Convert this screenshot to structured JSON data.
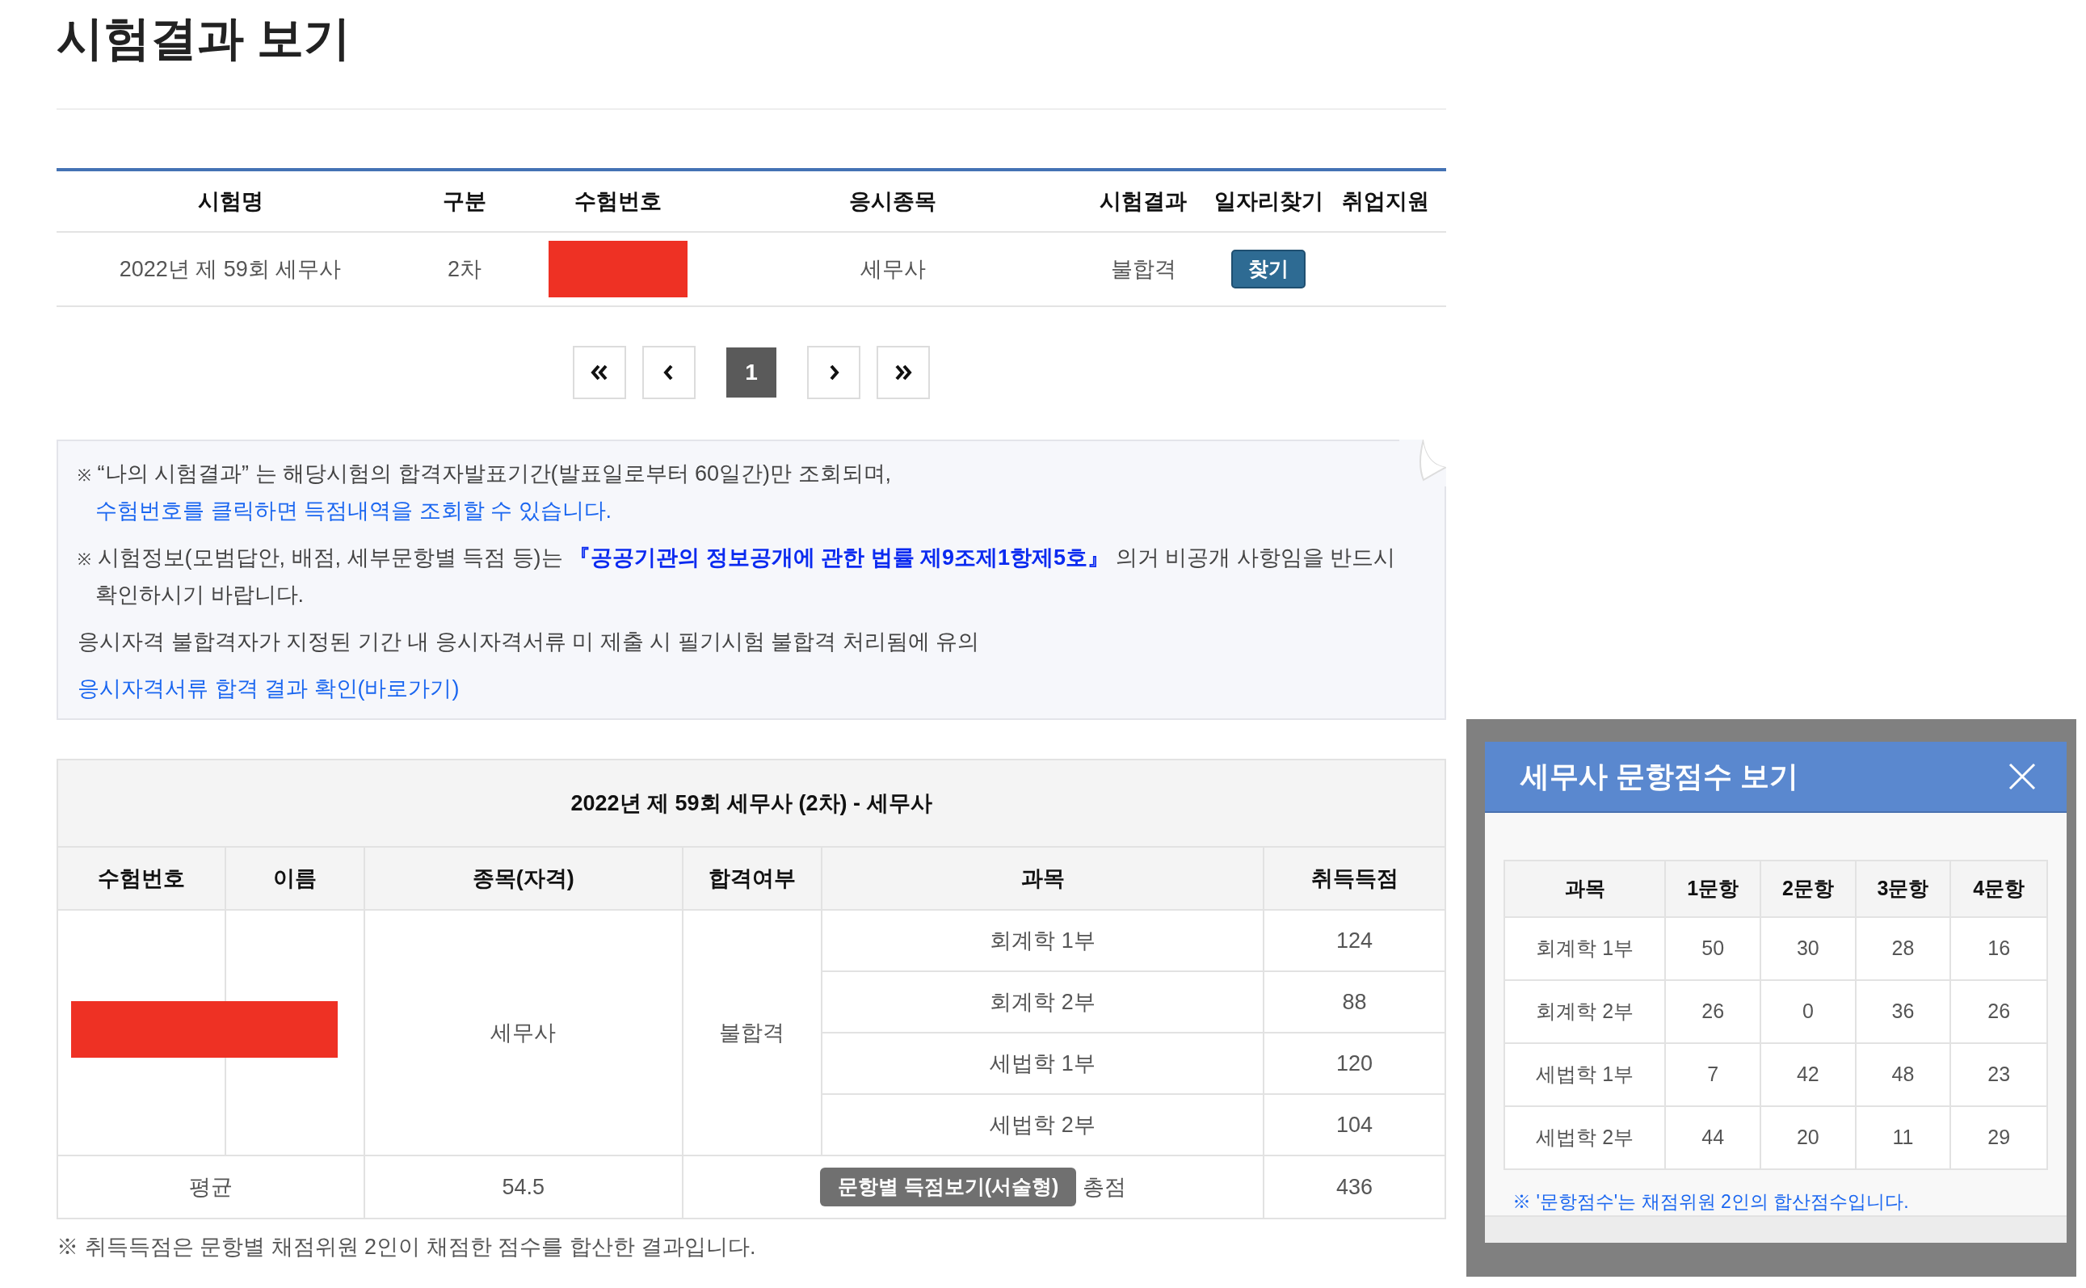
{
  "page_title": "시험결과 보기",
  "exam_list": {
    "columns": [
      "시험명",
      "구분",
      "수험번호",
      "응시종목",
      "시험결과",
      "일자리찾기",
      "취업지원"
    ],
    "rows": [
      {
        "exam_name": "2022년 제 59회 세무사",
        "stage": "2차",
        "subject": "세무사",
        "result": "불합격",
        "find_button": "찾기"
      }
    ]
  },
  "pagination": {
    "pages": [
      {
        "label": "1",
        "selected": true
      }
    ]
  },
  "notices": [
    {
      "mark": "※",
      "parts": [
        {
          "kind": "text",
          "text": "“나의 시험결과” 는 해당시험의 합격자발표기간(발표일로부터 60일간)만 조회되며, "
        },
        {
          "kind": "link",
          "text": "수험번호를 클릭하면 득점내역을 조회할 수 있습니다."
        }
      ]
    },
    {
      "mark": "※",
      "parts": [
        {
          "kind": "text",
          "text": "시험정보(모범답안, 배점, 세부문항별 득점 등)는 "
        },
        {
          "kind": "strong-link",
          "text": "『공공기관의 정보공개에 관한 법률 제9조제1항제5호』"
        },
        {
          "kind": "text",
          "text": " 의거 비공개 사항임을 반드시 확인하시기 바랍니다."
        }
      ]
    },
    {
      "parts": [
        {
          "kind": "text",
          "text": "응시자격 불합격자가 지정된 기간 내 응시자격서류 미 제출 시 필기시험 불합격 처리됨에 유의"
        }
      ]
    },
    {
      "parts": [
        {
          "kind": "link",
          "text": "응시자격서류 합격 결과 확인(바로가기)"
        }
      ]
    }
  ],
  "result_table": {
    "title": "2022년 제 59회 세무사 (2차) - 세무사",
    "columns": [
      "수험번호",
      "이름",
      "종목(자격)",
      "합격여부",
      "과목",
      "취득득점"
    ],
    "qualification": "세무사",
    "pass_status": "불합격",
    "subjects": [
      {
        "name": "회계학 1부",
        "score": "124"
      },
      {
        "name": "회계학 2부",
        "score": "88"
      },
      {
        "name": "세법학 1부",
        "score": "120"
      },
      {
        "name": "세법학 2부",
        "score": "104"
      }
    ],
    "average_label": "평균",
    "average": "54.5",
    "detail_button": "문항별 득점보기(서술형)",
    "total_label": "총점",
    "total": "436"
  },
  "footnote": "※ 취득득점은 문항별 채점위원 2인이 채점한 점수를 합산한 결과입니다.",
  "modal": {
    "title": "세무사 문항점수 보기",
    "columns": [
      "과목",
      "1문항",
      "2문항",
      "3문항",
      "4문항"
    ],
    "rows": [
      [
        "회계학 1부",
        "50",
        "30",
        "28",
        "16"
      ],
      [
        "회계학 2부",
        "26",
        "0",
        "36",
        "26"
      ],
      [
        "세법학 1부",
        "7",
        "42",
        "48",
        "23"
      ],
      [
        "세법학 2부",
        "44",
        "20",
        "11",
        "29"
      ]
    ],
    "note": "※ '문항점수'는 채점위원 2인의 합산점수입니다."
  }
}
